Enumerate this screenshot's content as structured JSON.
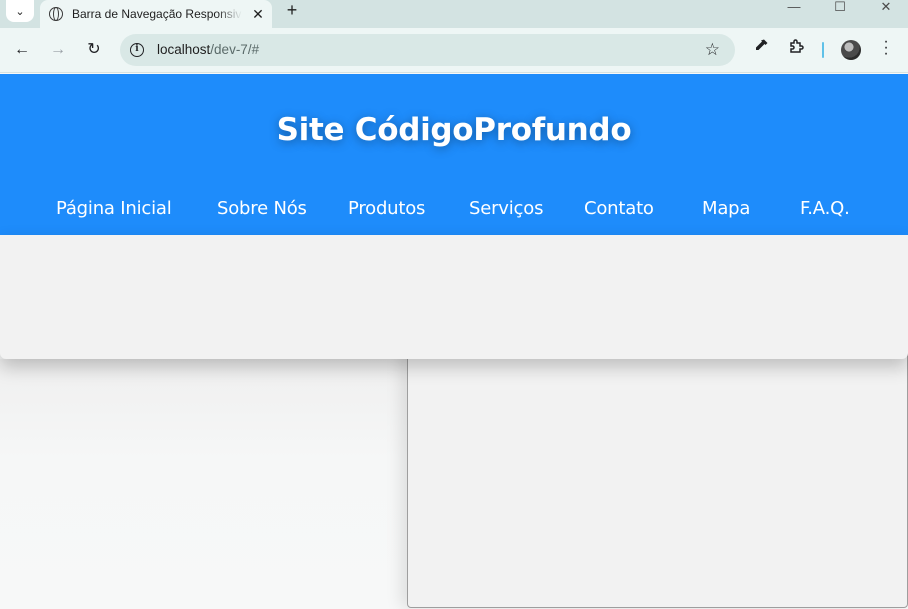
{
  "browser": {
    "tab_title": "Barra de Navegação Responsiva",
    "tab_close": "✕",
    "new_tab": "+",
    "url_host": "localhost",
    "url_path": "/dev-7/#",
    "window_controls": {
      "minimize": "—",
      "maximize": "☐",
      "close": "✕"
    },
    "icons": [
      "tab-search-icon",
      "globe-icon",
      "back-icon",
      "forward-icon",
      "reload-icon",
      "info-icon",
      "star-icon",
      "eyedropper-icon",
      "extensions-icon",
      "profile-avatar",
      "menu-icon"
    ]
  },
  "site": {
    "title": "Site CódigoProfundo",
    "nav": [
      {
        "label": "Página Inicial"
      },
      {
        "label": "Sobre Nós"
      },
      {
        "label": "Produtos"
      },
      {
        "label": "Serviços"
      },
      {
        "label": "Contato"
      },
      {
        "label": "Mapa"
      },
      {
        "label": "F.A.Q."
      }
    ]
  },
  "colors": {
    "header_bg": "#1e8cfb",
    "header_text": "#ffffff",
    "panel_bg": "#f2f2f2",
    "chrome_frame": "#d3e3e2"
  }
}
